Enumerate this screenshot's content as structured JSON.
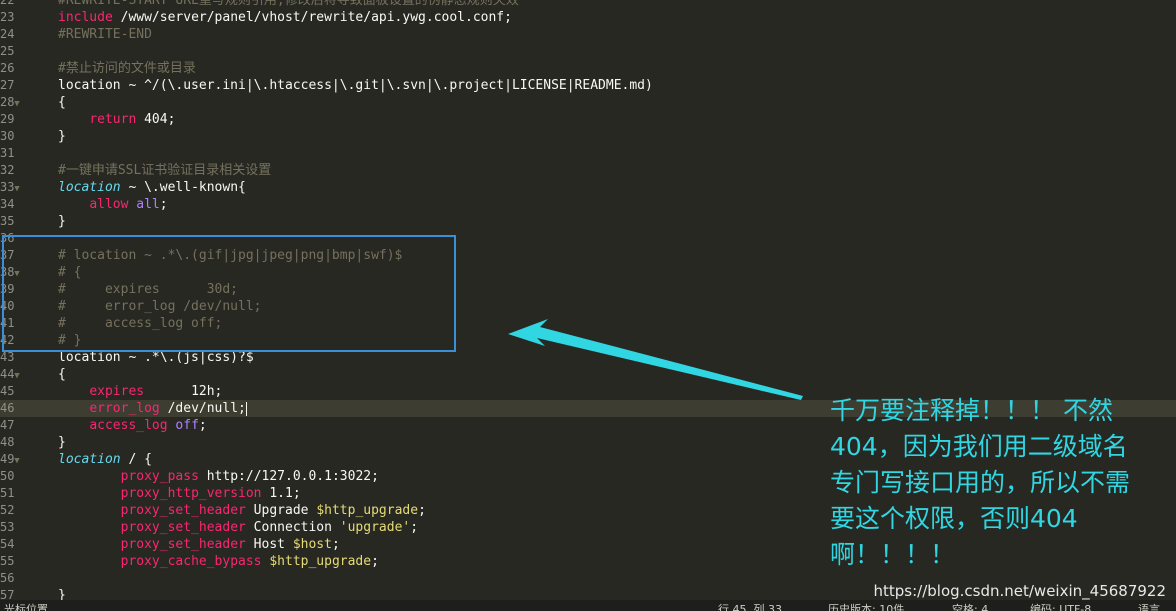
{
  "editor": {
    "lines": [
      {
        "num": "22",
        "tokens": [
          {
            "c": "comment",
            "t": "#REWRITE-START URL重写规则引用,修改后将导致面板设置的伪静态规则失效"
          }
        ]
      },
      {
        "num": "23",
        "tokens": [
          {
            "c": "keyword",
            "t": "include"
          },
          {
            "c": "plain",
            "t": " /www/server/panel/vhost/rewrite/api.ywg.cool.conf;"
          }
        ]
      },
      {
        "num": "24",
        "tokens": [
          {
            "c": "comment",
            "t": "#REWRITE-END"
          }
        ]
      },
      {
        "num": "25",
        "tokens": []
      },
      {
        "num": "26",
        "tokens": [
          {
            "c": "comment",
            "t": "#禁止访问的文件或目录"
          }
        ]
      },
      {
        "num": "27",
        "tokens": [
          {
            "c": "plain",
            "t": "location ~ ^/(\\.user.ini|\\.htaccess|\\.git|\\.svn|\\.project|LICENSE|README.md)"
          }
        ]
      },
      {
        "num": "28",
        "fold": true,
        "tokens": [
          {
            "c": "plain",
            "t": "{"
          }
        ]
      },
      {
        "num": "29",
        "tokens": [
          {
            "c": "plain",
            "t": "    "
          },
          {
            "c": "keyword",
            "t": "return"
          },
          {
            "c": "plain",
            "t": " 404;"
          }
        ]
      },
      {
        "num": "30",
        "tokens": [
          {
            "c": "plain",
            "t": "}"
          }
        ]
      },
      {
        "num": "31",
        "tokens": []
      },
      {
        "num": "32",
        "tokens": [
          {
            "c": "comment",
            "t": "#一键申请SSL证书验证目录相关设置"
          }
        ]
      },
      {
        "num": "33",
        "fold": true,
        "tokens": [
          {
            "c": "italic",
            "t": "location"
          },
          {
            "c": "plain",
            "t": " ~ \\.well-known{"
          }
        ]
      },
      {
        "num": "34",
        "tokens": [
          {
            "c": "plain",
            "t": "    "
          },
          {
            "c": "keyword",
            "t": "allow"
          },
          {
            "c": "plain",
            "t": " "
          },
          {
            "c": "const",
            "t": "all"
          },
          {
            "c": "plain",
            "t": ";"
          }
        ]
      },
      {
        "num": "35",
        "tokens": [
          {
            "c": "plain",
            "t": "}"
          }
        ]
      },
      {
        "num": "36",
        "tokens": []
      },
      {
        "num": "37",
        "tokens": [
          {
            "c": "comment",
            "t": "# location ~ .*\\.(gif|jpg|jpeg|png|bmp|swf)$"
          }
        ]
      },
      {
        "num": "38",
        "fold": true,
        "tokens": [
          {
            "c": "comment",
            "t": "# {"
          }
        ]
      },
      {
        "num": "39",
        "tokens": [
          {
            "c": "comment",
            "t": "#     expires      30d;"
          }
        ]
      },
      {
        "num": "40",
        "tokens": [
          {
            "c": "comment",
            "t": "#     error_log /dev/null;"
          }
        ]
      },
      {
        "num": "41",
        "tokens": [
          {
            "c": "comment",
            "t": "#     access_log off;"
          }
        ]
      },
      {
        "num": "42",
        "tokens": [
          {
            "c": "comment",
            "t": "# }"
          }
        ]
      },
      {
        "num": "43",
        "tokens": [
          {
            "c": "plain",
            "t": "location ~ .*\\.(js|css)?$"
          }
        ]
      },
      {
        "num": "44",
        "fold": true,
        "tokens": [
          {
            "c": "plain",
            "t": "{"
          }
        ]
      },
      {
        "num": "45",
        "tokens": [
          {
            "c": "plain",
            "t": "    "
          },
          {
            "c": "keyword",
            "t": "expires"
          },
          {
            "c": "plain",
            "t": "      12h;"
          }
        ]
      },
      {
        "num": "46",
        "active": true,
        "cursor": true,
        "tokens": [
          {
            "c": "plain",
            "t": "    "
          },
          {
            "c": "keyword",
            "t": "error_log"
          },
          {
            "c": "plain",
            "t": " /dev/null;"
          }
        ]
      },
      {
        "num": "47",
        "tokens": [
          {
            "c": "plain",
            "t": "    "
          },
          {
            "c": "keyword",
            "t": "access_log"
          },
          {
            "c": "plain",
            "t": " "
          },
          {
            "c": "const",
            "t": "off"
          },
          {
            "c": "plain",
            "t": ";"
          }
        ]
      },
      {
        "num": "48",
        "tokens": [
          {
            "c": "plain",
            "t": "}"
          }
        ]
      },
      {
        "num": "49",
        "fold": true,
        "tokens": [
          {
            "c": "italic",
            "t": "location"
          },
          {
            "c": "plain",
            "t": " / {"
          }
        ]
      },
      {
        "num": "50",
        "tokens": [
          {
            "c": "plain",
            "t": "        "
          },
          {
            "c": "keyword",
            "t": "proxy_pass"
          },
          {
            "c": "plain",
            "t": " http://127.0.0.1:3022;"
          }
        ]
      },
      {
        "num": "51",
        "tokens": [
          {
            "c": "plain",
            "t": "        "
          },
          {
            "c": "keyword",
            "t": "proxy_http_version"
          },
          {
            "c": "plain",
            "t": " 1.1;"
          }
        ]
      },
      {
        "num": "52",
        "tokens": [
          {
            "c": "plain",
            "t": "        "
          },
          {
            "c": "keyword",
            "t": "proxy_set_header"
          },
          {
            "c": "plain",
            "t": " Upgrade "
          },
          {
            "c": "var",
            "t": "$http_upgrade"
          },
          {
            "c": "plain",
            "t": ";"
          }
        ]
      },
      {
        "num": "53",
        "tokens": [
          {
            "c": "plain",
            "t": "        "
          },
          {
            "c": "keyword",
            "t": "proxy_set_header"
          },
          {
            "c": "plain",
            "t": " Connection "
          },
          {
            "c": "string",
            "t": "'upgrade'"
          },
          {
            "c": "plain",
            "t": ";"
          }
        ]
      },
      {
        "num": "54",
        "tokens": [
          {
            "c": "plain",
            "t": "        "
          },
          {
            "c": "keyword",
            "t": "proxy_set_header"
          },
          {
            "c": "plain",
            "t": " Host "
          },
          {
            "c": "var",
            "t": "$host"
          },
          {
            "c": "plain",
            "t": ";"
          }
        ]
      },
      {
        "num": "55",
        "tokens": [
          {
            "c": "plain",
            "t": "        "
          },
          {
            "c": "keyword",
            "t": "proxy_cache_bypass"
          },
          {
            "c": "plain",
            "t": " "
          },
          {
            "c": "var",
            "t": "$http_upgrade"
          },
          {
            "c": "plain",
            "t": ";"
          }
        ]
      },
      {
        "num": "56",
        "tokens": [
          {
            "c": "plain",
            "t": "    "
          }
        ]
      },
      {
        "num": "57",
        "tokens": [
          {
            "c": "plain",
            "t": "}"
          }
        ]
      }
    ]
  },
  "annotation": {
    "lines": [
      "千万要注释掉！！！ 不然",
      "404，因为我们用二级域名",
      "专门写接口用的，所以不需",
      "要这个权限，否则404",
      "啊！！！！"
    ]
  },
  "watermark": "https://blog.csdn.net/weixin_45687922",
  "statusbar": {
    "left": "光标位置...",
    "cursor_pos": "行 45, 列 33",
    "history": "历史版本: 10件",
    "indent": "空格: 4",
    "encoding": "编码: UTF-8",
    "language": "语言"
  },
  "colors": {
    "background": "#272822",
    "highlight_box": "#3a8fd8",
    "annotation_text": "#31d6e3"
  }
}
